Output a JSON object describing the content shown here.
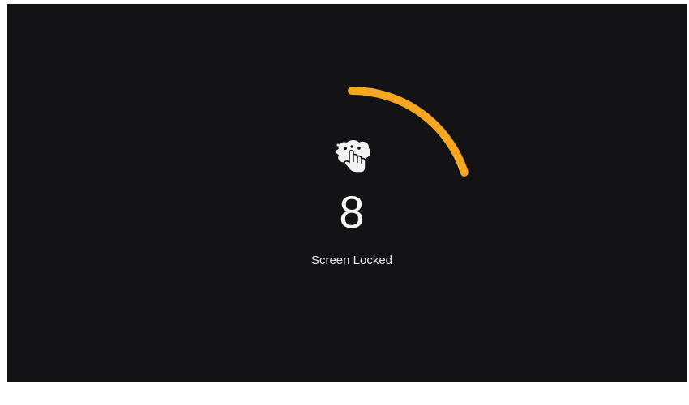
{
  "lock_screen": {
    "icon": "hand-touch-locked-icon",
    "countdown": "8",
    "status_text": "Screen Locked",
    "progress_fraction": 0.2,
    "progress_color": "#f5a623",
    "background_color": "#131316"
  }
}
